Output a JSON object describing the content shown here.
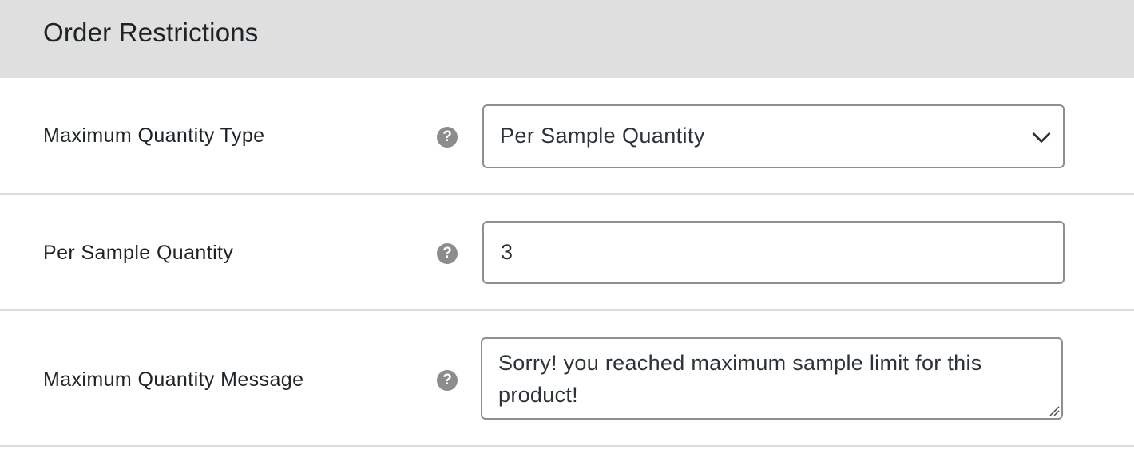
{
  "section": {
    "title": "Order Restrictions"
  },
  "fields": [
    {
      "label": "Maximum Quantity Type",
      "help_icon": "question-circle-icon",
      "control": "select",
      "value": "Per Sample Quantity",
      "icon": "chevron-down-icon"
    },
    {
      "label": "Per Sample Quantity",
      "help_icon": "question-circle-icon",
      "control": "number-input",
      "value": "3"
    },
    {
      "label": "Maximum Quantity Message",
      "help_icon": "question-circle-icon",
      "control": "textarea",
      "value": "Sorry! you reached maximum sample limit for this product!"
    }
  ],
  "help_glyph": "?",
  "colors": {
    "header_bg": "#dfdfdf",
    "border": "#8c8f94",
    "help_icon": "#8c8c8c",
    "divider": "#dcdcde"
  }
}
